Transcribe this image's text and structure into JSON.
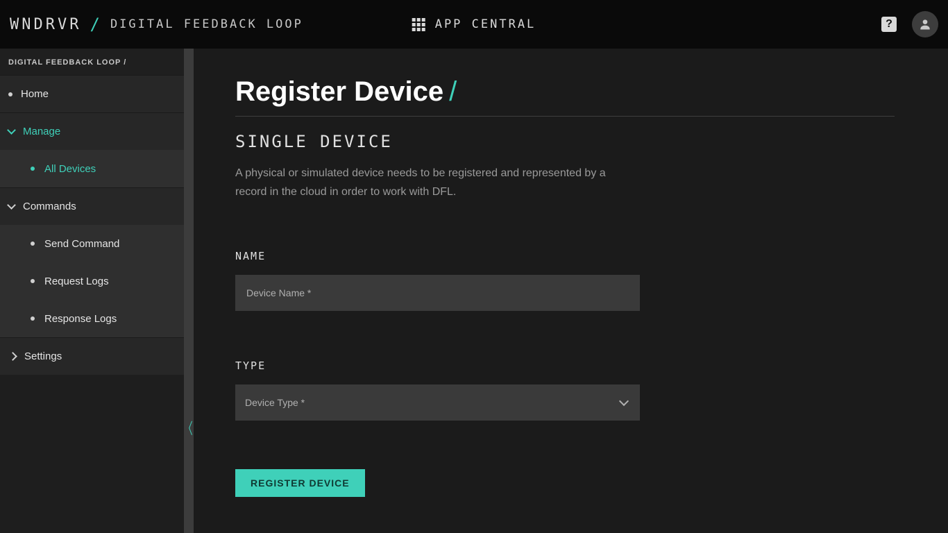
{
  "header": {
    "brand": "WNDRVR",
    "app_name": "DIGITAL FEEDBACK LOOP",
    "center_label": "APP CENTRAL",
    "help_glyph": "?",
    "avatar_glyph": "👤"
  },
  "sidebar": {
    "breadcrumb": "DIGITAL FEEDBACK LOOP  /",
    "home": "Home",
    "manage": "Manage",
    "manage_items": {
      "all_devices": "All Devices"
    },
    "commands": "Commands",
    "commands_items": {
      "send_command": "Send Command",
      "request_logs": "Request Logs",
      "response_logs": "Response Logs"
    },
    "settings": "Settings"
  },
  "main": {
    "title": "Register Device",
    "section_title": "SINGLE DEVICE",
    "section_desc": "A physical or simulated device needs to be registered and represented by a record in the cloud in order to work with DFL.",
    "fields": {
      "name_label": "NAME",
      "name_placeholder": "Device Name *",
      "name_value": "",
      "type_label": "TYPE",
      "type_placeholder": "Device Type *",
      "type_value": ""
    },
    "submit_label": "REGISTER DEVICE"
  },
  "colors": {
    "accent": "#3fd0b9"
  }
}
